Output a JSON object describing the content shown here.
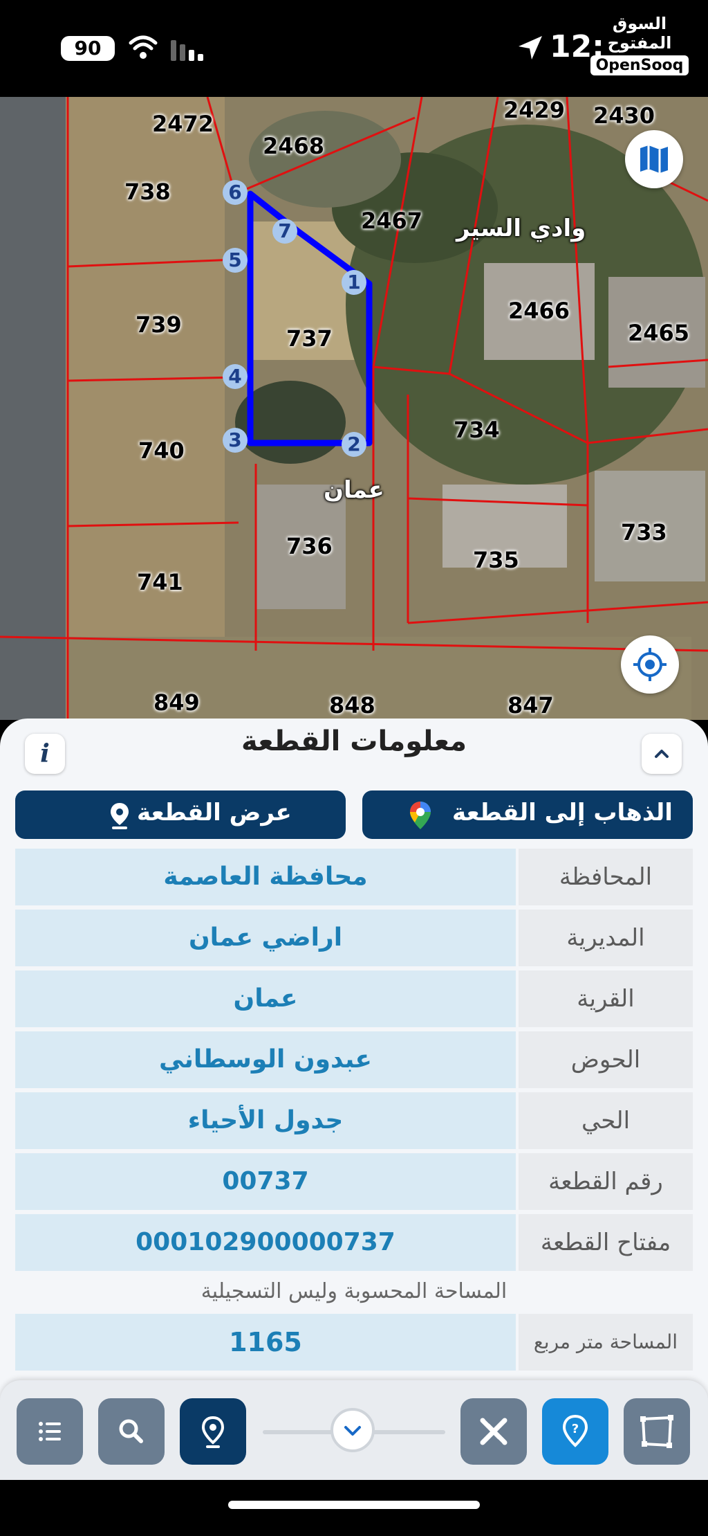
{
  "status_bar": {
    "battery": "90",
    "time": "12:",
    "watermark_ar": "السوق المفتوح",
    "watermark_en": "OpenSooq"
  },
  "map": {
    "parcel_labels": [
      "2472",
      "2468",
      "2429",
      "2430",
      "738",
      "2467",
      "2466",
      "2465",
      "739",
      "737",
      "734",
      "740",
      "733",
      "736",
      "735",
      "741",
      "849",
      "848",
      "847"
    ],
    "area_names": [
      "وادي السير",
      "عمان"
    ],
    "vertices": [
      "6",
      "7",
      "5",
      "1",
      "4",
      "3",
      "2"
    ],
    "parcel_outline_color": "#0000ff",
    "boundary_color": "#e01010"
  },
  "sheet": {
    "title": "معلومات القطعة",
    "info_label": "i",
    "view_parcel_button": "عرض القطعة",
    "go_to_parcel_button": "الذهاب إلى القطعة",
    "rows": [
      {
        "label": "المحافظة",
        "value": "محافظة العاصمة"
      },
      {
        "label": "المديرية",
        "value": "اراضي عمان"
      },
      {
        "label": "القرية",
        "value": "عمان"
      },
      {
        "label": "الحوض",
        "value": "عبدون الوسطاني"
      },
      {
        "label": "الحي",
        "value": "جدول الأحياء"
      },
      {
        "label": "رقم القطعة",
        "value": "00737"
      },
      {
        "label": "مفتاح القطعة",
        "value": "000102900000737"
      }
    ],
    "area_note": "المساحة المحسوبة وليس التسجيلية",
    "area_label": "المساحة متر مربع",
    "area_value": "1165"
  },
  "toolbar": {
    "tools": [
      "list-icon",
      "search-icon",
      "parcel-pin-icon",
      "expand-chevron-icon",
      "measure-tool-icon",
      "help-pin-icon",
      "polygon-select-icon"
    ]
  }
}
